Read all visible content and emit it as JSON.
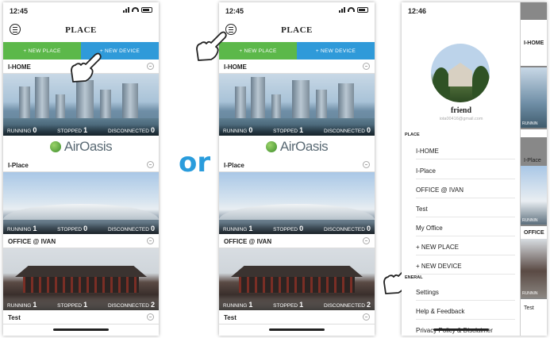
{
  "screen1": {
    "time": "12:45",
    "title": "PLACE",
    "new_place": "+ NEW PLACE",
    "new_device": "+ NEW DEVICE",
    "places": [
      {
        "name": "I-HOME",
        "running": "0",
        "stopped": "1",
        "disconnected": "0"
      },
      {
        "name": "I-Place",
        "running": "1",
        "stopped": "0",
        "disconnected": "0"
      },
      {
        "name": "OFFICE @ IVAN",
        "running": "1",
        "stopped": "1",
        "disconnected": "2"
      },
      {
        "name": "Test"
      }
    ],
    "labels": {
      "running": "RUNNING",
      "stopped": "STOPPED",
      "disconnected": "DISCONNECTED"
    },
    "brand": "AirOasis"
  },
  "or_label": "or",
  "screen3": {
    "time": "12:46",
    "user_name": "friend",
    "user_email": "iota00416@gmail.com",
    "section_place": "PLACE",
    "section_general": "ENERAL",
    "place_items": [
      "I-HOME",
      "I-Place",
      "OFFICE @ IVAN",
      "Test",
      "My Office",
      "+ NEW PLACE",
      "+ NEW DEVICE"
    ],
    "general_items": [
      "Settings",
      "Help & Feedback",
      "Privacy Policy & Disclaimer"
    ],
    "peek_items": [
      "I-HOME",
      "RUNNIN",
      "I-Place",
      "RUNNIN",
      "OFFICE",
      "RUNNIN",
      "Test"
    ]
  },
  "colors": {
    "new_place": "#5cb84a",
    "new_device": "#2f9ad9",
    "or": "#2a9cdc"
  }
}
